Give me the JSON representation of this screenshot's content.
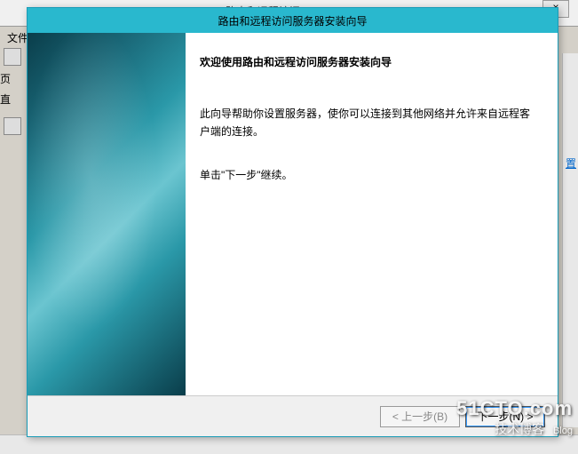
{
  "background": {
    "title": "路由和远程访问",
    "menu_file": "文件",
    "side_char1": "页",
    "side_char2": "直",
    "right_link": "置",
    "close_x": "×"
  },
  "wizard": {
    "title": "路由和远程访问服务器安装向导",
    "heading": "欢迎使用路由和远程访问服务器安装向导",
    "body1": "此向导帮助你设置服务器，使你可以连接到其他网络并允许来自远程客户端的连接。",
    "body2": "单击\"下一步\"继续。",
    "back_label": "< 上一步(B)",
    "next_label": "下一步(N) >"
  },
  "watermark": {
    "line1": "51CTO.com",
    "line2_main": "技术博客",
    "line2_small": "Blog"
  }
}
